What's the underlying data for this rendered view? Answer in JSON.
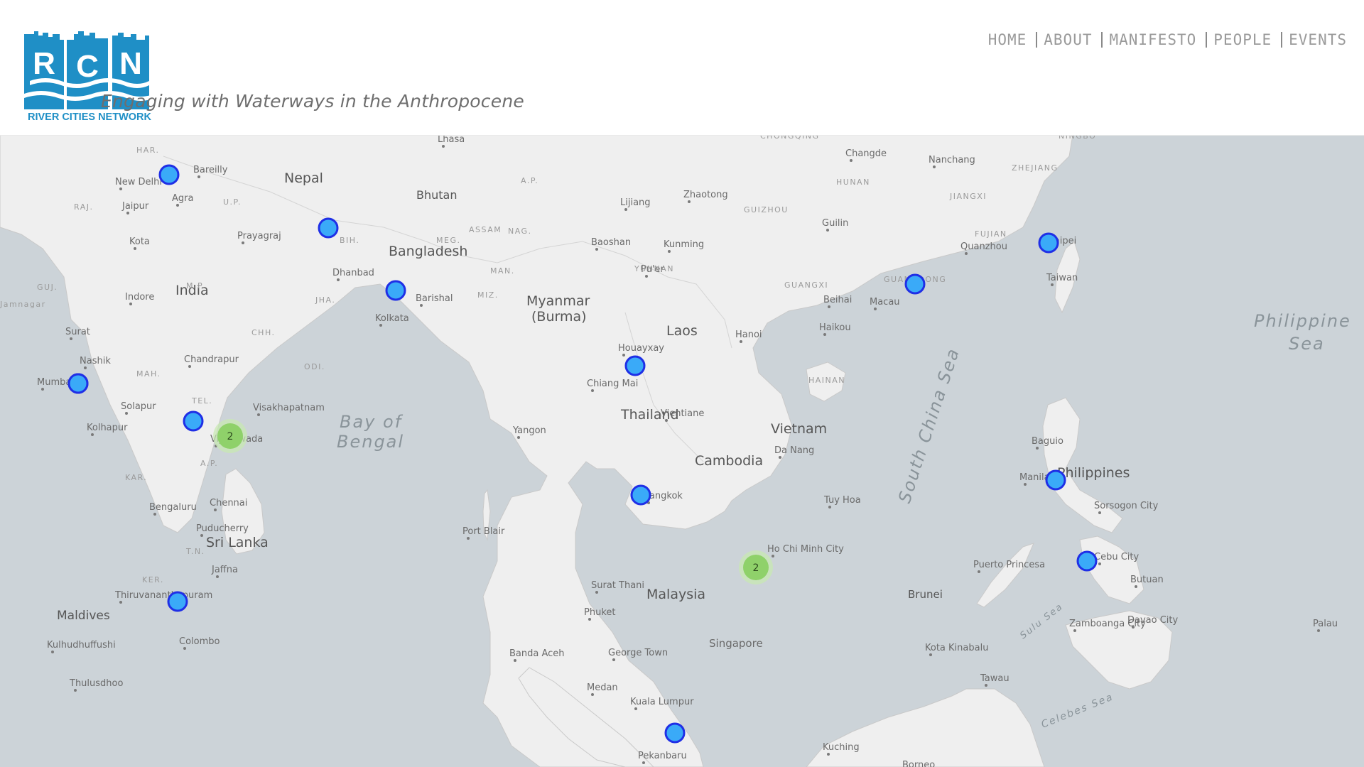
{
  "brand": {
    "letters": [
      "R",
      "C",
      "N"
    ],
    "name": "RIVER CITIES NETWORK",
    "tagline": "Engaging with Waterways in the Anthropocene",
    "color": "#1f8fc6"
  },
  "nav": [
    {
      "label": "HOME"
    },
    {
      "label": "ABOUT"
    },
    {
      "label": "MANIFESTO"
    },
    {
      "label": "PEOPLE"
    },
    {
      "label": "EVENTS"
    }
  ],
  "map": {
    "colors": {
      "water": "#ccd3d8",
      "land": "#efefef",
      "marker_fill": "#3aaaf8",
      "marker_stroke": "#1f2fe6",
      "cluster_fill": "#8fd16a",
      "cluster_halo": "#c8e9b0"
    },
    "country_labels": [
      "Nepal",
      "Bhutan",
      "Bangladesh",
      "India",
      "Myanmar",
      "(Burma)",
      "Laos",
      "Thailand",
      "Vietnam",
      "Cambodia",
      "Sri Lanka",
      "Maldives",
      "Malaysia",
      "Singapore",
      "Brunei",
      "Philippines"
    ],
    "sea_labels": [
      "Bay of",
      "Bengal",
      "South China Sea",
      "Philippine",
      "Sea",
      "Sulu Sea",
      "Celebes Sea"
    ],
    "city_labels": [
      "Lhasa",
      "New Delhi",
      "Bareilly",
      "Agra",
      "Jaipur",
      "Kota",
      "Prayagraj",
      "Dhanbad",
      "Barishal",
      "Kolkata",
      "Indore",
      "Surat",
      "Nashik",
      "Chandrapur",
      "Mumbai",
      "Solapur",
      "Kolhapur",
      "Vijayawada",
      "Visakhapatnam",
      "Bengaluru",
      "Chennai",
      "Puducherry",
      "Jaffna",
      "Thiruvananthapuram",
      "Colombo",
      "Kulhudhuffushi",
      "Thulusdhoo",
      "Port Blair",
      "Lijiang",
      "Zhaotong",
      "Baoshan",
      "Kunming",
      "Pu'er",
      "Houayxay",
      "Chiang Mai",
      "Vientiane",
      "Hanoi",
      "Yangon",
      "Bangkok",
      "Da Nang",
      "Tuy Hoa",
      "Ho Chi Minh City",
      "Surat Thani",
      "Phuket",
      "Banda Aceh",
      "George Town",
      "Medan",
      "Kuala Lumpur",
      "Pekanbaru",
      "Kuching",
      "Changde",
      "Nanchang",
      "Guilin",
      "Quanzhou",
      "Taipei",
      "Taiwan",
      "Macau",
      "Beihai",
      "Haikou",
      "Baguio",
      "Manila",
      "Sorsogon City",
      "Puerto Princesa",
      "Cebu City",
      "Butuan",
      "Zamboanga City",
      "Davao City",
      "Palau",
      "Kota Kinabalu",
      "Tawau",
      "Borneo"
    ],
    "region_labels": [
      "HAR.",
      "RAJ.",
      "U.P.",
      "BIH.",
      "GUJ.",
      "M.P.",
      "JHA.",
      "CHH.",
      "MAH.",
      "ODI.",
      "TEL.",
      "A.P.",
      "KAR.",
      "T.N.",
      "KER.",
      "MEG.",
      "ASSAM",
      "NAG.",
      "MIZ.",
      "MAN.",
      "A.P.",
      "YUNNAN",
      "GUIZHOU",
      "HUNAN",
      "JIANGXI",
      "FUJIAN",
      "ZHEJIANG",
      "GUANGXI",
      "GUANGDONG",
      "HAINAN",
      "CHONGQING",
      "NINGBO",
      "Jamnagar"
    ],
    "markers": [
      {
        "type": "point"
      },
      {
        "type": "point"
      },
      {
        "type": "point"
      },
      {
        "type": "point"
      },
      {
        "type": "point"
      },
      {
        "type": "cluster",
        "count": "2"
      },
      {
        "type": "point"
      },
      {
        "type": "point"
      },
      {
        "type": "point"
      },
      {
        "type": "point"
      },
      {
        "type": "point"
      },
      {
        "type": "cluster",
        "count": "2"
      },
      {
        "type": "point"
      },
      {
        "type": "point"
      },
      {
        "type": "point"
      },
      {
        "type": "point"
      }
    ]
  }
}
